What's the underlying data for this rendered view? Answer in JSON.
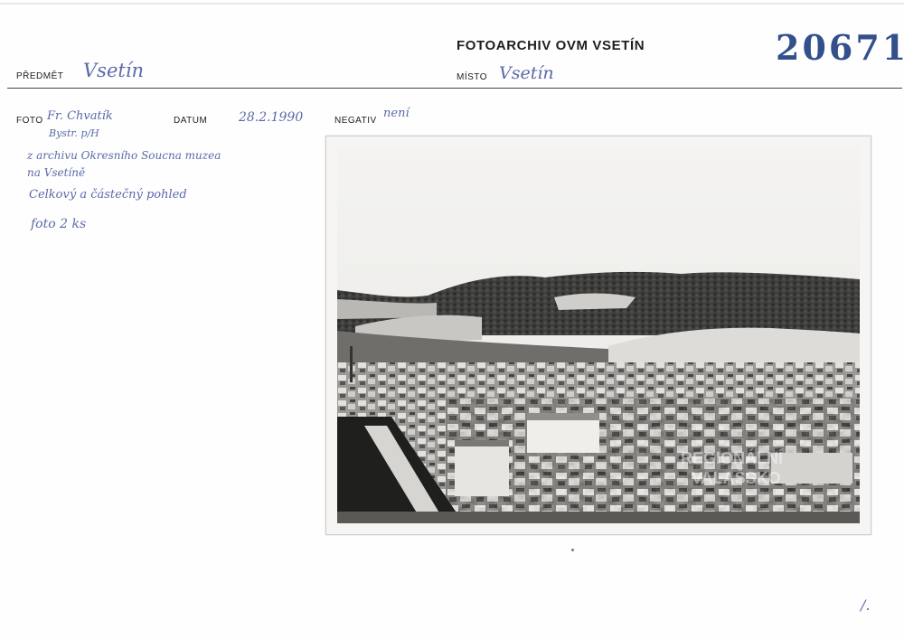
{
  "header": {
    "archive_title": "FOTOARCHIV OVM VSETÍN",
    "inventory_number": "20671",
    "subject_label": "PŘEDMĚT",
    "subject_value": "Vsetín",
    "place_label": "MÍSTO",
    "place_value": "Vsetín"
  },
  "details": {
    "photo_label": "FOTO",
    "photographer": "Fr. Chvatík",
    "photographer_place": "Bystr. p/H",
    "date_label": "DATUM",
    "date_value": "28.2.1990",
    "negative_label": "NEGATIV",
    "negative_value": "není"
  },
  "notes": [
    "z archivu Okresního Soucna muzea",
    "na Vsetíně",
    "Celkový a částečný pohled",
    "foto 2 ks"
  ],
  "photo": {
    "watermark_line1": "REGIONÁLNÍ",
    "watermark_line2": "VALAŠSKO"
  },
  "footer": {
    "mark": "/."
  }
}
